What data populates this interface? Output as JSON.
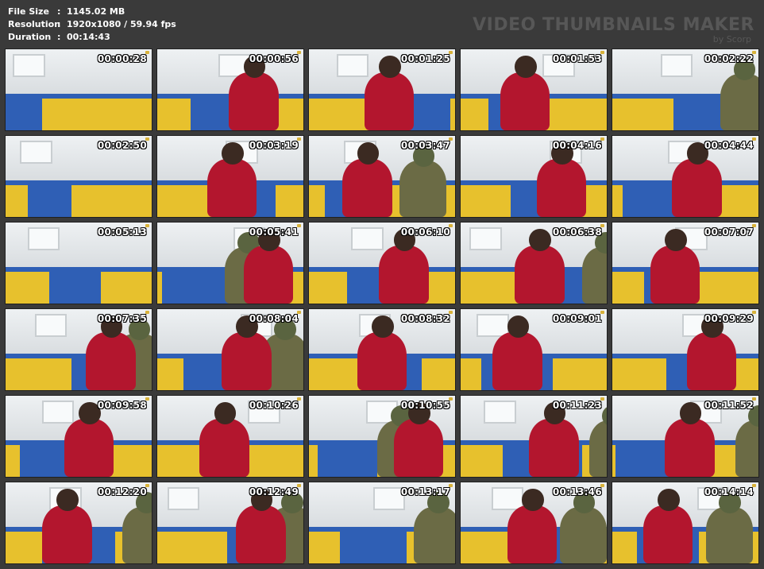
{
  "meta": {
    "file_size_label": "File Size",
    "file_size": "1145.02 MB",
    "resolution_label": "Resolution",
    "resolution": "1920x1080 / 59.94 fps",
    "duration_label": "Duration",
    "duration": "00:14:43",
    "separator": ":"
  },
  "brand": {
    "title": "VIDEO THUMBNAILS MAKER",
    "subtitle": "by Scorp"
  },
  "thumbnails": [
    {
      "time": "00:00:28"
    },
    {
      "time": "00:00:56"
    },
    {
      "time": "00:01:25"
    },
    {
      "time": "00:01:53"
    },
    {
      "time": "00:02:22"
    },
    {
      "time": "00:02:50"
    },
    {
      "time": "00:03:19"
    },
    {
      "time": "00:03:47"
    },
    {
      "time": "00:04:16"
    },
    {
      "time": "00:04:44"
    },
    {
      "time": "00:05:13"
    },
    {
      "time": "00:05:41"
    },
    {
      "time": "00:06:10"
    },
    {
      "time": "00:06:38"
    },
    {
      "time": "00:07:07"
    },
    {
      "time": "00:07:35"
    },
    {
      "time": "00:08:04"
    },
    {
      "time": "00:08:32"
    },
    {
      "time": "00:09:01"
    },
    {
      "time": "00:09:29"
    },
    {
      "time": "00:09:58"
    },
    {
      "time": "00:10:26"
    },
    {
      "time": "00:10:55"
    },
    {
      "time": "00:11:23"
    },
    {
      "time": "00:11:52"
    },
    {
      "time": "00:12:20"
    },
    {
      "time": "00:12:49"
    },
    {
      "time": "00:13:17"
    },
    {
      "time": "00:13:46"
    },
    {
      "time": "00:14:14"
    }
  ],
  "colors": {
    "background": "#3a3a3a",
    "mat_yellow": "#e7c12d",
    "mat_blue": "#2f5fb5",
    "top_red": "#b3162e",
    "olive": "#6b6b45"
  }
}
